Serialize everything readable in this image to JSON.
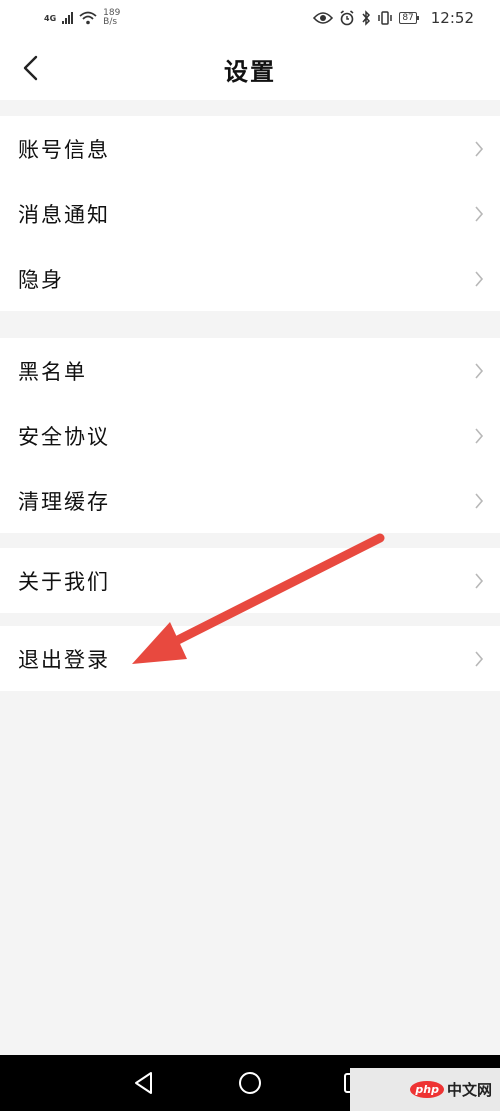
{
  "status_bar": {
    "network": "4G",
    "speed_value": "189",
    "speed_unit": "B/s",
    "battery": "87",
    "time": "12:52"
  },
  "header": {
    "title": "设置",
    "back_icon": "chevron-left-icon"
  },
  "groups": [
    {
      "items": [
        {
          "label": "账号信息"
        },
        {
          "label": "消息通知"
        },
        {
          "label": "隐身"
        }
      ]
    },
    {
      "items": [
        {
          "label": "黑名单"
        },
        {
          "label": "安全协议"
        },
        {
          "label": "清理缓存"
        }
      ]
    },
    {
      "items": [
        {
          "label": "关于我们"
        }
      ]
    },
    {
      "items": [
        {
          "label": "退出登录"
        }
      ]
    }
  ],
  "annotation": {
    "color": "#e8493f"
  },
  "watermark": {
    "logo": "php",
    "text": "中文网"
  },
  "colors": {
    "background": "#f4f4f4",
    "surface": "#ffffff",
    "chevron": "#b8b8b8",
    "navbar": "#000000"
  }
}
